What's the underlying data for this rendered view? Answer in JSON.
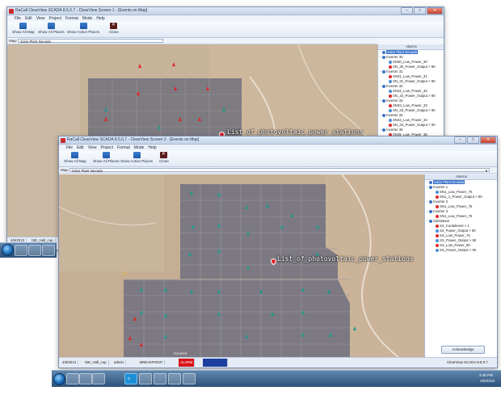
{
  "back_window": {
    "title": "RaCall ClearView SCADA 8.5.0.7 - ClearView Screen 1 - [Events on Map]",
    "menu": [
      "File",
      "Edit",
      "View",
      "Project",
      "Format",
      "Mode",
      "Help"
    ],
    "ribbon": [
      "Show All Map",
      "Show All Places",
      "Show Active Places",
      "Close"
    ],
    "map_label": "Map:",
    "map_value": "Solar Plant Nevada",
    "overlay_label": "List_of_photovoltaic_power_stations",
    "tree_header": "Alarms",
    "tree": [
      {
        "text": "Solar Plant Nevada",
        "selected": true
      },
      {
        "text": "Inverter 30"
      },
      {
        "text": "SN30_Low_Power_30"
      },
      {
        "text": "SN_30_Power_Output > 90"
      },
      {
        "text": "Inverter 31"
      },
      {
        "text": "SN31_Low_Power_31"
      },
      {
        "text": "SN_31_Power_Output > 90"
      },
      {
        "text": "Inverter 32"
      },
      {
        "text": "SN32_Low_Power_32"
      },
      {
        "text": "SN_32_Power_Output > 90"
      },
      {
        "text": "Inverter 33"
      },
      {
        "text": "SN33_Low_Power_33"
      },
      {
        "text": "SN_33_Power_Output > 90"
      },
      {
        "text": "Inverter 34"
      },
      {
        "text": "SN34_Low_Power_34"
      },
      {
        "text": "SN_34_Power_Output > 90"
      },
      {
        "text": "Inverter 35"
      },
      {
        "text": "SN35_Low_Power_35"
      }
    ],
    "status_date": "4/6/2013",
    "status_task": "ISE_Hall_cup"
  },
  "front_window": {
    "title": "RaCall ClearView SCADA 8.5.0.7 - ClearView Screen 2 - [Events on Map]",
    "menu": [
      "File",
      "Edit",
      "View",
      "Project",
      "Format",
      "Mode",
      "Help"
    ],
    "ribbon": [
      "Show All Map",
      "Show All Places",
      "Show Active Places",
      "Close"
    ],
    "map_label": "Map:",
    "map_value": "Solar Plant Nevada",
    "overlay_label": "List_of_photovoltaic_power_stations",
    "tree_header": "Alarms",
    "tree": [
      {
        "text": "Solar Plant Nevada",
        "selected": true
      },
      {
        "text": "Inverter 1"
      },
      {
        "text": "SN1_Low_Power_75"
      },
      {
        "text": "SN1_1_Power_Output > 90"
      },
      {
        "text": "Inverter 2"
      },
      {
        "text": "SN1_Low_Power_75"
      },
      {
        "text": "Inverter 3"
      },
      {
        "text": "SN1_Low_Power_75"
      },
      {
        "text": "Substation"
      },
      {
        "text": "S2_Curtailment > 1"
      },
      {
        "text": "S2_Power_Output > 90"
      },
      {
        "text": "SS_Low_Power_75"
      },
      {
        "text": "SS_Power_Output > 90"
      },
      {
        "text": "SS_Low_Power_90"
      },
      {
        "text": "SS_Power_Output > 90"
      }
    ],
    "acknowledge_label": "Acknowledge",
    "status_date": "4/6/2013",
    "status_task": "ISE_Hall_cup",
    "status_user": "admin",
    "status_user2": "BREAKPOINT",
    "status_alarm": "ALARM",
    "status_product": "ClearView SCADA 8.5.0.7",
    "zoom_label": "Zoomed"
  },
  "taskbar": {
    "clock_time": "3:45 PM",
    "clock_date": "4/6/2013"
  },
  "colors": {
    "alarm": "#e0262a",
    "ok": "#22998c",
    "selection": "#3a73c8"
  }
}
